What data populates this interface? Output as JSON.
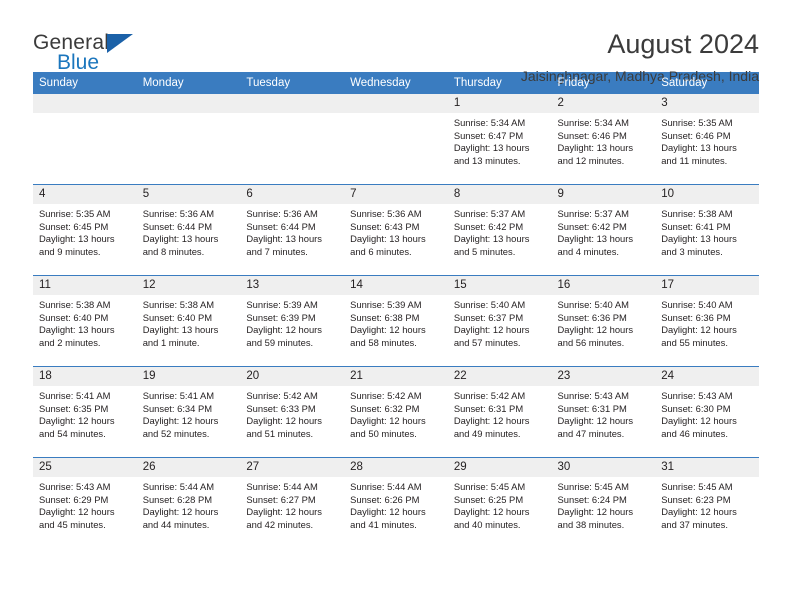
{
  "brand": {
    "name_top": "General",
    "name_bottom": "Blue",
    "accent_color": "#1b76bd",
    "triangle_color": "#1b61a8"
  },
  "header": {
    "title": "August 2024",
    "subtitle": "Jaisinghnagar, Madhya Pradesh, India"
  },
  "calendar": {
    "header_bg": "#3a7cc0",
    "daynum_bg": "#efefef",
    "weekdays": [
      "Sunday",
      "Monday",
      "Tuesday",
      "Wednesday",
      "Thursday",
      "Friday",
      "Saturday"
    ],
    "weeks": [
      [
        {
          "day": "",
          "empty": true
        },
        {
          "day": "",
          "empty": true
        },
        {
          "day": "",
          "empty": true
        },
        {
          "day": "",
          "empty": true
        },
        {
          "day": "1",
          "sunrise": "Sunrise: 5:34 AM",
          "sunset": "Sunset: 6:47 PM",
          "daylight": "Daylight: 13 hours and 13 minutes."
        },
        {
          "day": "2",
          "sunrise": "Sunrise: 5:34 AM",
          "sunset": "Sunset: 6:46 PM",
          "daylight": "Daylight: 13 hours and 12 minutes."
        },
        {
          "day": "3",
          "sunrise": "Sunrise: 5:35 AM",
          "sunset": "Sunset: 6:46 PM",
          "daylight": "Daylight: 13 hours and 11 minutes."
        }
      ],
      [
        {
          "day": "4",
          "sunrise": "Sunrise: 5:35 AM",
          "sunset": "Sunset: 6:45 PM",
          "daylight": "Daylight: 13 hours and 9 minutes."
        },
        {
          "day": "5",
          "sunrise": "Sunrise: 5:36 AM",
          "sunset": "Sunset: 6:44 PM",
          "daylight": "Daylight: 13 hours and 8 minutes."
        },
        {
          "day": "6",
          "sunrise": "Sunrise: 5:36 AM",
          "sunset": "Sunset: 6:44 PM",
          "daylight": "Daylight: 13 hours and 7 minutes."
        },
        {
          "day": "7",
          "sunrise": "Sunrise: 5:36 AM",
          "sunset": "Sunset: 6:43 PM",
          "daylight": "Daylight: 13 hours and 6 minutes."
        },
        {
          "day": "8",
          "sunrise": "Sunrise: 5:37 AM",
          "sunset": "Sunset: 6:42 PM",
          "daylight": "Daylight: 13 hours and 5 minutes."
        },
        {
          "day": "9",
          "sunrise": "Sunrise: 5:37 AM",
          "sunset": "Sunset: 6:42 PM",
          "daylight": "Daylight: 13 hours and 4 minutes."
        },
        {
          "day": "10",
          "sunrise": "Sunrise: 5:38 AM",
          "sunset": "Sunset: 6:41 PM",
          "daylight": "Daylight: 13 hours and 3 minutes."
        }
      ],
      [
        {
          "day": "11",
          "sunrise": "Sunrise: 5:38 AM",
          "sunset": "Sunset: 6:40 PM",
          "daylight": "Daylight: 13 hours and 2 minutes."
        },
        {
          "day": "12",
          "sunrise": "Sunrise: 5:38 AM",
          "sunset": "Sunset: 6:40 PM",
          "daylight": "Daylight: 13 hours and 1 minute."
        },
        {
          "day": "13",
          "sunrise": "Sunrise: 5:39 AM",
          "sunset": "Sunset: 6:39 PM",
          "daylight": "Daylight: 12 hours and 59 minutes."
        },
        {
          "day": "14",
          "sunrise": "Sunrise: 5:39 AM",
          "sunset": "Sunset: 6:38 PM",
          "daylight": "Daylight: 12 hours and 58 minutes."
        },
        {
          "day": "15",
          "sunrise": "Sunrise: 5:40 AM",
          "sunset": "Sunset: 6:37 PM",
          "daylight": "Daylight: 12 hours and 57 minutes."
        },
        {
          "day": "16",
          "sunrise": "Sunrise: 5:40 AM",
          "sunset": "Sunset: 6:36 PM",
          "daylight": "Daylight: 12 hours and 56 minutes."
        },
        {
          "day": "17",
          "sunrise": "Sunrise: 5:40 AM",
          "sunset": "Sunset: 6:36 PM",
          "daylight": "Daylight: 12 hours and 55 minutes."
        }
      ],
      [
        {
          "day": "18",
          "sunrise": "Sunrise: 5:41 AM",
          "sunset": "Sunset: 6:35 PM",
          "daylight": "Daylight: 12 hours and 54 minutes."
        },
        {
          "day": "19",
          "sunrise": "Sunrise: 5:41 AM",
          "sunset": "Sunset: 6:34 PM",
          "daylight": "Daylight: 12 hours and 52 minutes."
        },
        {
          "day": "20",
          "sunrise": "Sunrise: 5:42 AM",
          "sunset": "Sunset: 6:33 PM",
          "daylight": "Daylight: 12 hours and 51 minutes."
        },
        {
          "day": "21",
          "sunrise": "Sunrise: 5:42 AM",
          "sunset": "Sunset: 6:32 PM",
          "daylight": "Daylight: 12 hours and 50 minutes."
        },
        {
          "day": "22",
          "sunrise": "Sunrise: 5:42 AM",
          "sunset": "Sunset: 6:31 PM",
          "daylight": "Daylight: 12 hours and 49 minutes."
        },
        {
          "day": "23",
          "sunrise": "Sunrise: 5:43 AM",
          "sunset": "Sunset: 6:31 PM",
          "daylight": "Daylight: 12 hours and 47 minutes."
        },
        {
          "day": "24",
          "sunrise": "Sunrise: 5:43 AM",
          "sunset": "Sunset: 6:30 PM",
          "daylight": "Daylight: 12 hours and 46 minutes."
        }
      ],
      [
        {
          "day": "25",
          "sunrise": "Sunrise: 5:43 AM",
          "sunset": "Sunset: 6:29 PM",
          "daylight": "Daylight: 12 hours and 45 minutes."
        },
        {
          "day": "26",
          "sunrise": "Sunrise: 5:44 AM",
          "sunset": "Sunset: 6:28 PM",
          "daylight": "Daylight: 12 hours and 44 minutes."
        },
        {
          "day": "27",
          "sunrise": "Sunrise: 5:44 AM",
          "sunset": "Sunset: 6:27 PM",
          "daylight": "Daylight: 12 hours and 42 minutes."
        },
        {
          "day": "28",
          "sunrise": "Sunrise: 5:44 AM",
          "sunset": "Sunset: 6:26 PM",
          "daylight": "Daylight: 12 hours and 41 minutes."
        },
        {
          "day": "29",
          "sunrise": "Sunrise: 5:45 AM",
          "sunset": "Sunset: 6:25 PM",
          "daylight": "Daylight: 12 hours and 40 minutes."
        },
        {
          "day": "30",
          "sunrise": "Sunrise: 5:45 AM",
          "sunset": "Sunset: 6:24 PM",
          "daylight": "Daylight: 12 hours and 38 minutes."
        },
        {
          "day": "31",
          "sunrise": "Sunrise: 5:45 AM",
          "sunset": "Sunset: 6:23 PM",
          "daylight": "Daylight: 12 hours and 37 minutes."
        }
      ]
    ]
  }
}
